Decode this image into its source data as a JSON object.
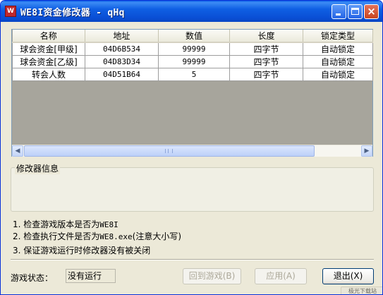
{
  "window": {
    "title": "WE8I资金修改器 - qHq",
    "icon": "app-icon"
  },
  "titlebar_buttons": {
    "minimize": "minimize-icon",
    "maximize": "maximize-icon",
    "close": "close-icon"
  },
  "table": {
    "columns": [
      "名称",
      "地址",
      "数值",
      "长度",
      "锁定类型"
    ],
    "rows": [
      {
        "name": "球会资金[甲级]",
        "address": "04D6B534",
        "value": "99999",
        "length": "四字节",
        "lock": "自动锁定"
      },
      {
        "name": "球会资金[乙级]",
        "address": "04D83D34",
        "value": "99999",
        "length": "四字节",
        "lock": "自动锁定"
      },
      {
        "name": "转会人数",
        "address": "04D51B64",
        "value": "5",
        "length": "四字节",
        "lock": "自动锁定"
      }
    ]
  },
  "info_group": {
    "title": "修改器信息"
  },
  "notes": [
    {
      "num": "1.",
      "text": "检查游戏版本是否为",
      "code": "WE8I",
      "suffix": ""
    },
    {
      "num": "2.",
      "text": "检查执行文件是否为",
      "code": "WE8.exe",
      "suffix": "(注意大小写)"
    },
    {
      "num": "3.",
      "text": "保证游戏运行时修改器没有被关闭",
      "code": "",
      "suffix": ""
    }
  ],
  "status": {
    "label": "游戏状态：",
    "value": "没有运行"
  },
  "buttons": {
    "return_label": "回到游戏(B)",
    "apply_label": "应用(A)",
    "exit_label": "退出(X)"
  },
  "watermark": "极光下载站",
  "colors": {
    "titlebar": "#0a4fd5",
    "window_bg": "#ece9d8",
    "table_empty_bg": "#a7a59c"
  }
}
